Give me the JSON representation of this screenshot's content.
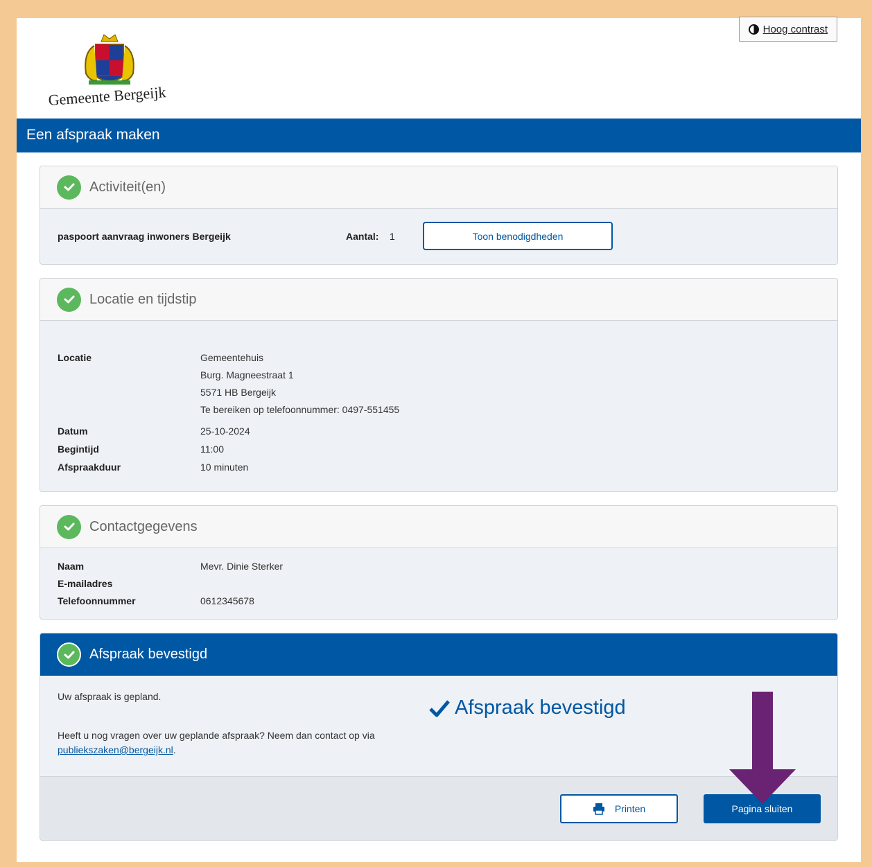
{
  "header": {
    "logo_text": "Gemeente Bergeijk",
    "contrast_label": "Hoog contrast"
  },
  "banner": {
    "title": "Een afspraak maken"
  },
  "activities": {
    "title": "Activiteit(en)",
    "name": "paspoort aanvraag inwoners Bergeijk",
    "aantal_label": "Aantal:",
    "aantal_value": "1",
    "button_label": "Toon benodigdheden"
  },
  "location": {
    "title": "Locatie en tijdstip",
    "locatie_label": "Locatie",
    "address": [
      "Gemeentehuis",
      "Burg. Magneestraat 1",
      "5571 HB Bergeijk",
      "Te bereiken op telefoonnummer: 0497-551455"
    ],
    "datum_label": "Datum",
    "datum_value": "25-10-2024",
    "begintijd_label": "Begintijd",
    "begintijd_value": "11:00",
    "duur_label": "Afspraakduur",
    "duur_value": "10 minuten"
  },
  "contact": {
    "title": "Contactgegevens",
    "naam_label": "Naam",
    "naam_value": "Mevr. Dinie Sterker",
    "email_label": "E-mailadres",
    "email_value": "",
    "tel_label": "Telefoonnummer",
    "tel_value": "0612345678"
  },
  "confirmation": {
    "title": "Afspraak bevestigd",
    "planned_text": "Uw afspraak is gepland.",
    "question_text": "Heeft u nog vragen over uw geplande afspraak? Neem dan contact op via",
    "email_link": "publiekszaken@bergeijk.nl",
    "email_suffix": ".",
    "big_label": "Afspraak bevestigd"
  },
  "footer": {
    "print_label": "Printen",
    "close_label": "Pagina sluiten"
  },
  "colors": {
    "brand_blue": "#0057a3",
    "success_green": "#5cb85c",
    "arrow_purple": "#6a2372",
    "frame_border": "#f5c993"
  },
  "icons": [
    "contrast-icon",
    "check-circle-icon",
    "checkmark-icon",
    "printer-icon",
    "arrow-down-icon"
  ]
}
